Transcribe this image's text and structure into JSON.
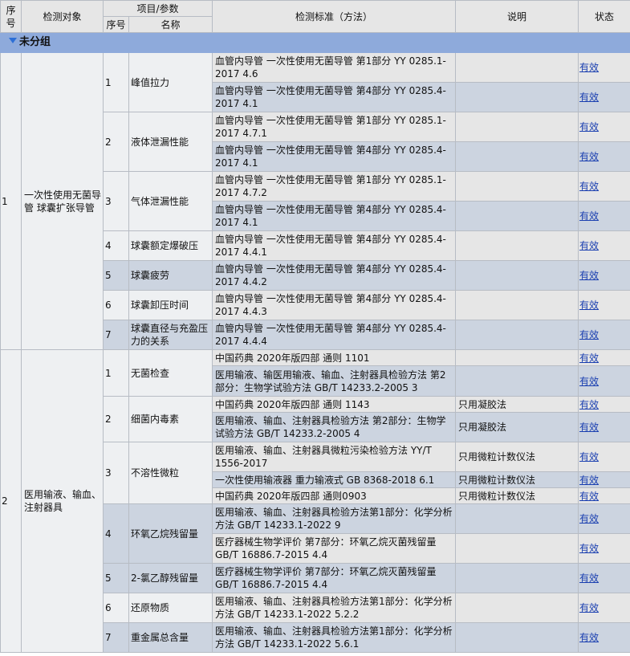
{
  "header": {
    "seq": "序号",
    "object": "检测对象",
    "item_param": "项目/参数",
    "item_seq": "序号",
    "item_name": "名称",
    "standard": "检测标准（方法）",
    "note": "说明",
    "status": "状态"
  },
  "group": {
    "label": "未分组"
  },
  "status_label": "有效",
  "objects": [
    {
      "seq": "1",
      "name": "一次性使用无菌导管 球囊扩张导管",
      "items": [
        {
          "seq": "1",
          "name": "峰值拉力",
          "standards": [
            {
              "std": "血管内导管 一次性使用无菌导管 第1部分 YY 0285.1-2017 4.6",
              "note": ""
            },
            {
              "std": "血管内导管 一次性使用无菌导管 第4部分 YY 0285.4-2017 4.1",
              "note": ""
            }
          ]
        },
        {
          "seq": "2",
          "name": "液体泄漏性能",
          "standards": [
            {
              "std": "血管内导管 一次性使用无菌导管 第1部分 YY 0285.1-2017 4.7.1",
              "note": ""
            },
            {
              "std": "血管内导管 一次性使用无菌导管 第4部分 YY 0285.4-2017 4.1",
              "note": ""
            }
          ]
        },
        {
          "seq": "3",
          "name": "气体泄漏性能",
          "standards": [
            {
              "std": "血管内导管 一次性使用无菌导管 第1部分 YY 0285.1-2017 4.7.2",
              "note": ""
            },
            {
              "std": "血管内导管 一次性使用无菌导管 第4部分 YY 0285.4-2017 4.1",
              "note": ""
            }
          ]
        },
        {
          "seq": "4",
          "name": "球囊额定爆破压",
          "standards": [
            {
              "std": "血管内导管 一次性使用无菌导管 第4部分 YY 0285.4-2017 4.4.1",
              "note": ""
            }
          ]
        },
        {
          "seq": "5",
          "name": "球囊疲劳",
          "standards": [
            {
              "std": "血管内导管 一次性使用无菌导管 第4部分 YY 0285.4-2017 4.4.2",
              "note": ""
            }
          ]
        },
        {
          "seq": "6",
          "name": "球囊卸压时间",
          "standards": [
            {
              "std": "血管内导管 一次性使用无菌导管 第4部分 YY 0285.4-2017 4.4.3",
              "note": ""
            }
          ]
        },
        {
          "seq": "7",
          "name": "球囊直径与充盈压力的关系",
          "standards": [
            {
              "std": "血管内导管 一次性使用无菌导管 第4部分 YY 0285.4-2017 4.4.4",
              "note": ""
            }
          ]
        }
      ]
    },
    {
      "seq": "2",
      "name": "医用输液、输血、注射器具",
      "items": [
        {
          "seq": "1",
          "name": "无菌检查",
          "standards": [
            {
              "std": "中国药典 2020年版四部 通则 1101",
              "note": ""
            },
            {
              "std": "医用输液、输医用输液、输血、注射器具检验方法 第2部分：生物学试验方法 GB/T 14233.2-2005 3",
              "note": ""
            }
          ]
        },
        {
          "seq": "2",
          "name": "细菌内毒素",
          "standards": [
            {
              "std": "中国药典 2020年版四部 通则 1143",
              "note": "只用凝胶法"
            },
            {
              "std": "医用输液、输血、注射器具检验方法 第2部分：生物学试验方法 GB/T 14233.2-2005 4",
              "note": "只用凝胶法"
            }
          ]
        },
        {
          "seq": "3",
          "name": "不溶性微粒",
          "standards": [
            {
              "std": "医用输液、输血、注射器具微粒污染检验方法 YY/T 1556-2017",
              "note": "只用微粒计数仪法"
            },
            {
              "std": "一次性使用输液器 重力输液式 GB 8368-2018 6.1",
              "note": "只用微粒计数仪法"
            },
            {
              "std": "中国药典 2020年版四部 通则0903",
              "note": "只用微粒计数仪法"
            }
          ]
        },
        {
          "seq": "4",
          "name": "环氧乙烷残留量",
          "standards": [
            {
              "std": "医用输液、输血、注射器具检验方法第1部分：化学分析方法 GB/T 14233.1-2022 9",
              "note": ""
            },
            {
              "std": "医疗器械生物学评价 第7部分：环氧乙烷灭菌残留量 GB/T 16886.7-2015 4.4",
              "note": ""
            }
          ]
        },
        {
          "seq": "5",
          "name": "2-氯乙醇残留量",
          "standards": [
            {
              "std": "医疗器械生物学评价 第7部分：环氧乙烷灭菌残留量 GB/T 16886.7-2015 4.4",
              "note": ""
            }
          ]
        },
        {
          "seq": "6",
          "name": "还原物质",
          "standards": [
            {
              "std": "医用输液、输血、注射器具检验方法第1部分：化学分析方法 GB/T 14233.1-2022 5.2.2",
              "note": ""
            }
          ]
        },
        {
          "seq": "7",
          "name": "重金属总含量",
          "standards": [
            {
              "std": "医用输液、输血、注射器具检验方法第1部分：化学分析方法 GB/T 14233.1-2022 5.6.1",
              "note": ""
            }
          ]
        }
      ]
    }
  ]
}
